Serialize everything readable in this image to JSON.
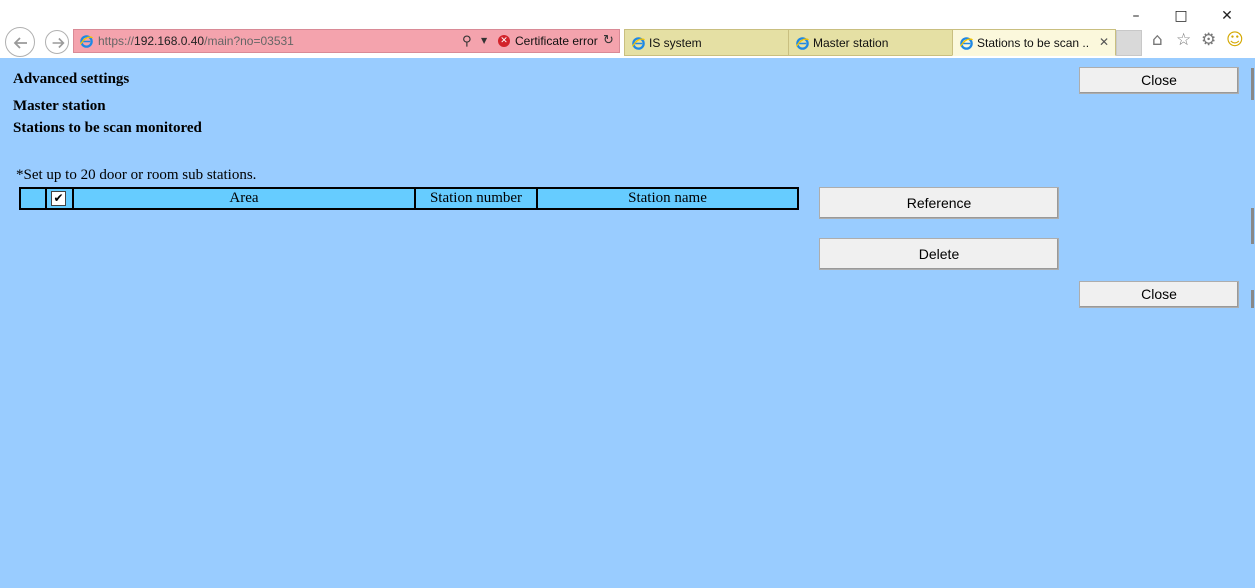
{
  "window": {
    "minimize_icon": "minimize-icon",
    "maximize_icon": "maximize-icon",
    "close_icon": "close-icon"
  },
  "address_bar": {
    "url_prefix": "https://",
    "url_host": "192.168.0.40",
    "url_path": "/main?no=03531",
    "certificate_error": "Certificate error",
    "bar_color": "#f4a3ad"
  },
  "tabs": [
    {
      "label": "IS system",
      "active": false
    },
    {
      "label": "Master station",
      "active": false
    },
    {
      "label": "Stations to be scan ...",
      "active": true
    }
  ],
  "toolbar_icons": [
    "home-icon",
    "favorites-star-icon",
    "settings-gear-icon",
    "smiley-feedback-icon"
  ],
  "page": {
    "background": "#99ccff",
    "title": "Advanced settings",
    "subtitle": "Master station",
    "section": "Stations to be scan monitored",
    "note": "*Set up to 20 door or room sub stations.",
    "close_top_label": "Close",
    "close_bottom_label": "Close",
    "reference_label": "Reference",
    "delete_label": "Delete"
  },
  "table": {
    "header_color": "#66ccff",
    "select_all_checked": true,
    "columns": [
      "Area",
      "Station number",
      "Station name"
    ],
    "rows": []
  }
}
